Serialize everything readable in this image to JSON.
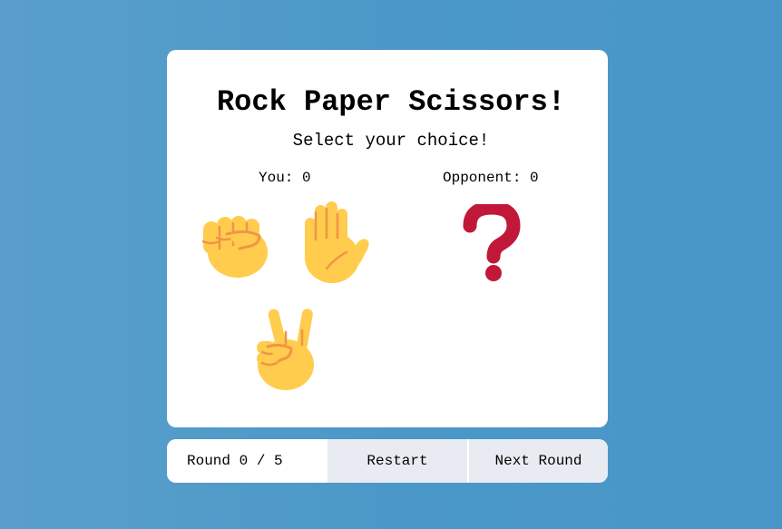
{
  "game": {
    "title": "Rock Paper Scissors!",
    "subtitle": "Select your choice!",
    "you_score_label": "You: 0",
    "opponent_score_label": "Opponent: 0"
  },
  "choices": [
    {
      "name": "rock",
      "icon": "raised-fist-icon"
    },
    {
      "name": "paper",
      "icon": "raised-hand-icon"
    },
    {
      "name": "scissors",
      "icon": "victory-hand-icon"
    }
  ],
  "opponent_choice_icon": "question-mark-icon",
  "footer": {
    "round_label": "Round 0 / 5",
    "restart_label": "Restart",
    "next_round_label": "Next Round"
  },
  "colors": {
    "background": "#4b98c8",
    "hand_yellow": "#ffd35c",
    "hand_line": "#ef9645",
    "question_red": "#c1183a",
    "button_bg": "#e8ecf2"
  }
}
